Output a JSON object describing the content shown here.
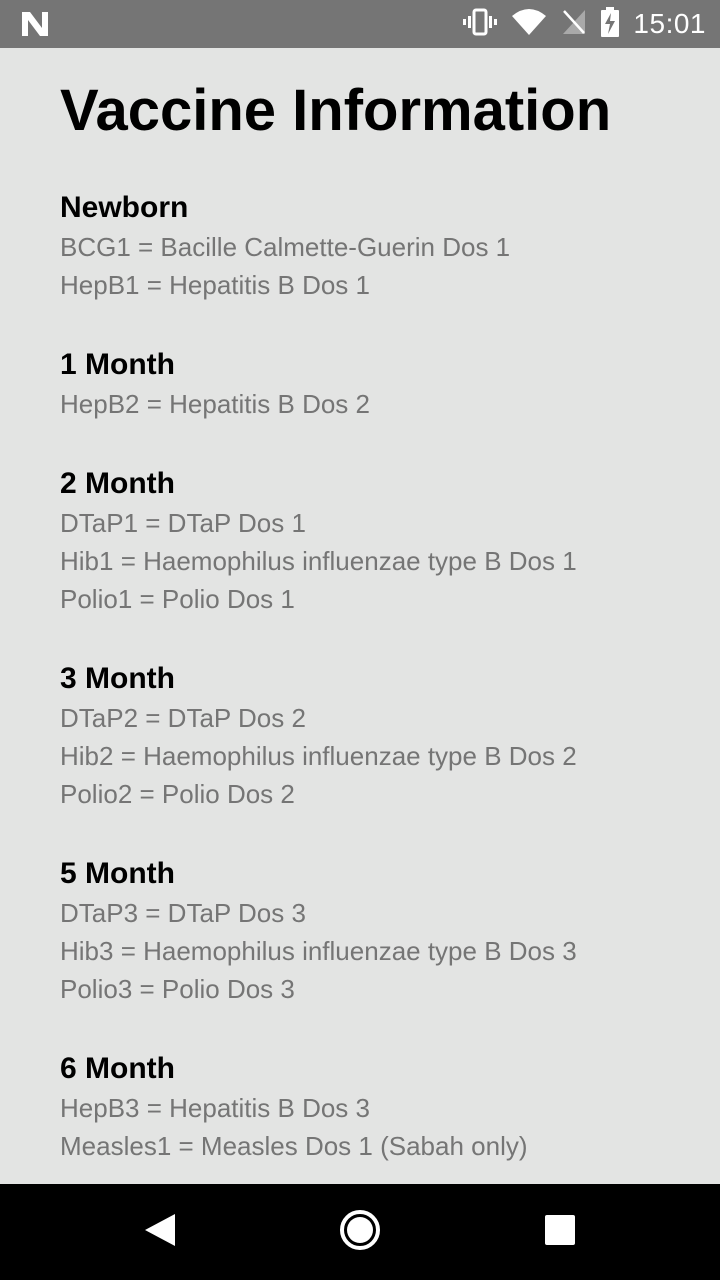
{
  "status_bar": {
    "time": "15:01",
    "icons": [
      "n-notification-icon",
      "vibrate-icon",
      "wifi-icon",
      "no-sim-icon",
      "battery-charging-icon"
    ]
  },
  "page": {
    "title": "Vaccine Information"
  },
  "sections": [
    {
      "heading": "Newborn",
      "items": [
        "BCG1 = Bacille Calmette-Guerin Dos 1",
        "HepB1 = Hepatitis B Dos 1"
      ]
    },
    {
      "heading": "1 Month",
      "items": [
        "HepB2 = Hepatitis B Dos 2"
      ]
    },
    {
      "heading": "2 Month",
      "items": [
        "DTaP1 = DTaP Dos 1",
        "Hib1 = Haemophilus influenzae type B Dos 1",
        "Polio1 = Polio Dos 1"
      ]
    },
    {
      "heading": "3 Month",
      "items": [
        "DTaP2 = DTaP Dos 2",
        "Hib2 = Haemophilus influenzae type B Dos 2",
        "Polio2 = Polio Dos 2"
      ]
    },
    {
      "heading": "5 Month",
      "items": [
        "DTaP3 = DTaP Dos 3",
        "Hib3 = Haemophilus influenzae type B Dos 3",
        "Polio3 = Polio Dos 3"
      ]
    },
    {
      "heading": "6 Month",
      "items": [
        "HepB3 = Hepatitis B Dos 3",
        "Measles1 = Measles Dos 1 (Sabah only)"
      ]
    }
  ],
  "nav_bar": {
    "icons": [
      "back-icon",
      "home-icon",
      "recents-icon"
    ]
  },
  "colors": {
    "background": "#e3e4e3",
    "status_bar": "#757575",
    "heading_text": "#000000",
    "item_text": "#757575",
    "nav_bar": "#000000"
  }
}
